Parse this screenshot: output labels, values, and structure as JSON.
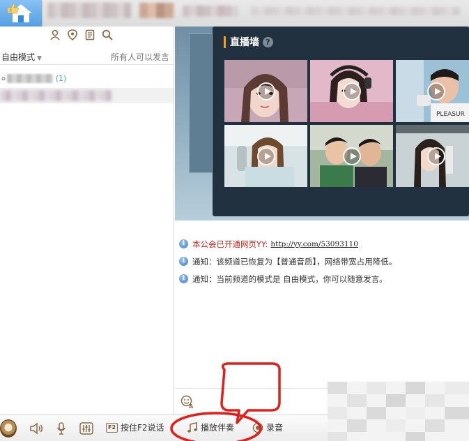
{
  "left": {
    "mode_label": "自由模式",
    "speak_hint": "所有人可以发言",
    "channel_count": "(1)"
  },
  "live_wall": {
    "title": "直播墙",
    "help_label": "?"
  },
  "chat": {
    "messages": [
      {
        "prefix": "本公会已开通网页YY:",
        "link": "http://yy.com/53093110"
      },
      {
        "text": "通知：该频道已恢复为【普通音质】，网络带宽占用降低。"
      },
      {
        "text": "通知：当前频道的模式是 自由模式，你可以随意发言。"
      }
    ]
  },
  "toolbar": {
    "push_to_talk_label": "按住F2说话",
    "f2_key_label": "F2",
    "accompaniment_label": "播放伴奏",
    "record_label": "录音"
  },
  "colors": {
    "accent_blue": "#3a8bd6",
    "icon_brown": "#8a6b48",
    "annotation_red": "#e0201b",
    "live_wall_bg": "#213140"
  }
}
